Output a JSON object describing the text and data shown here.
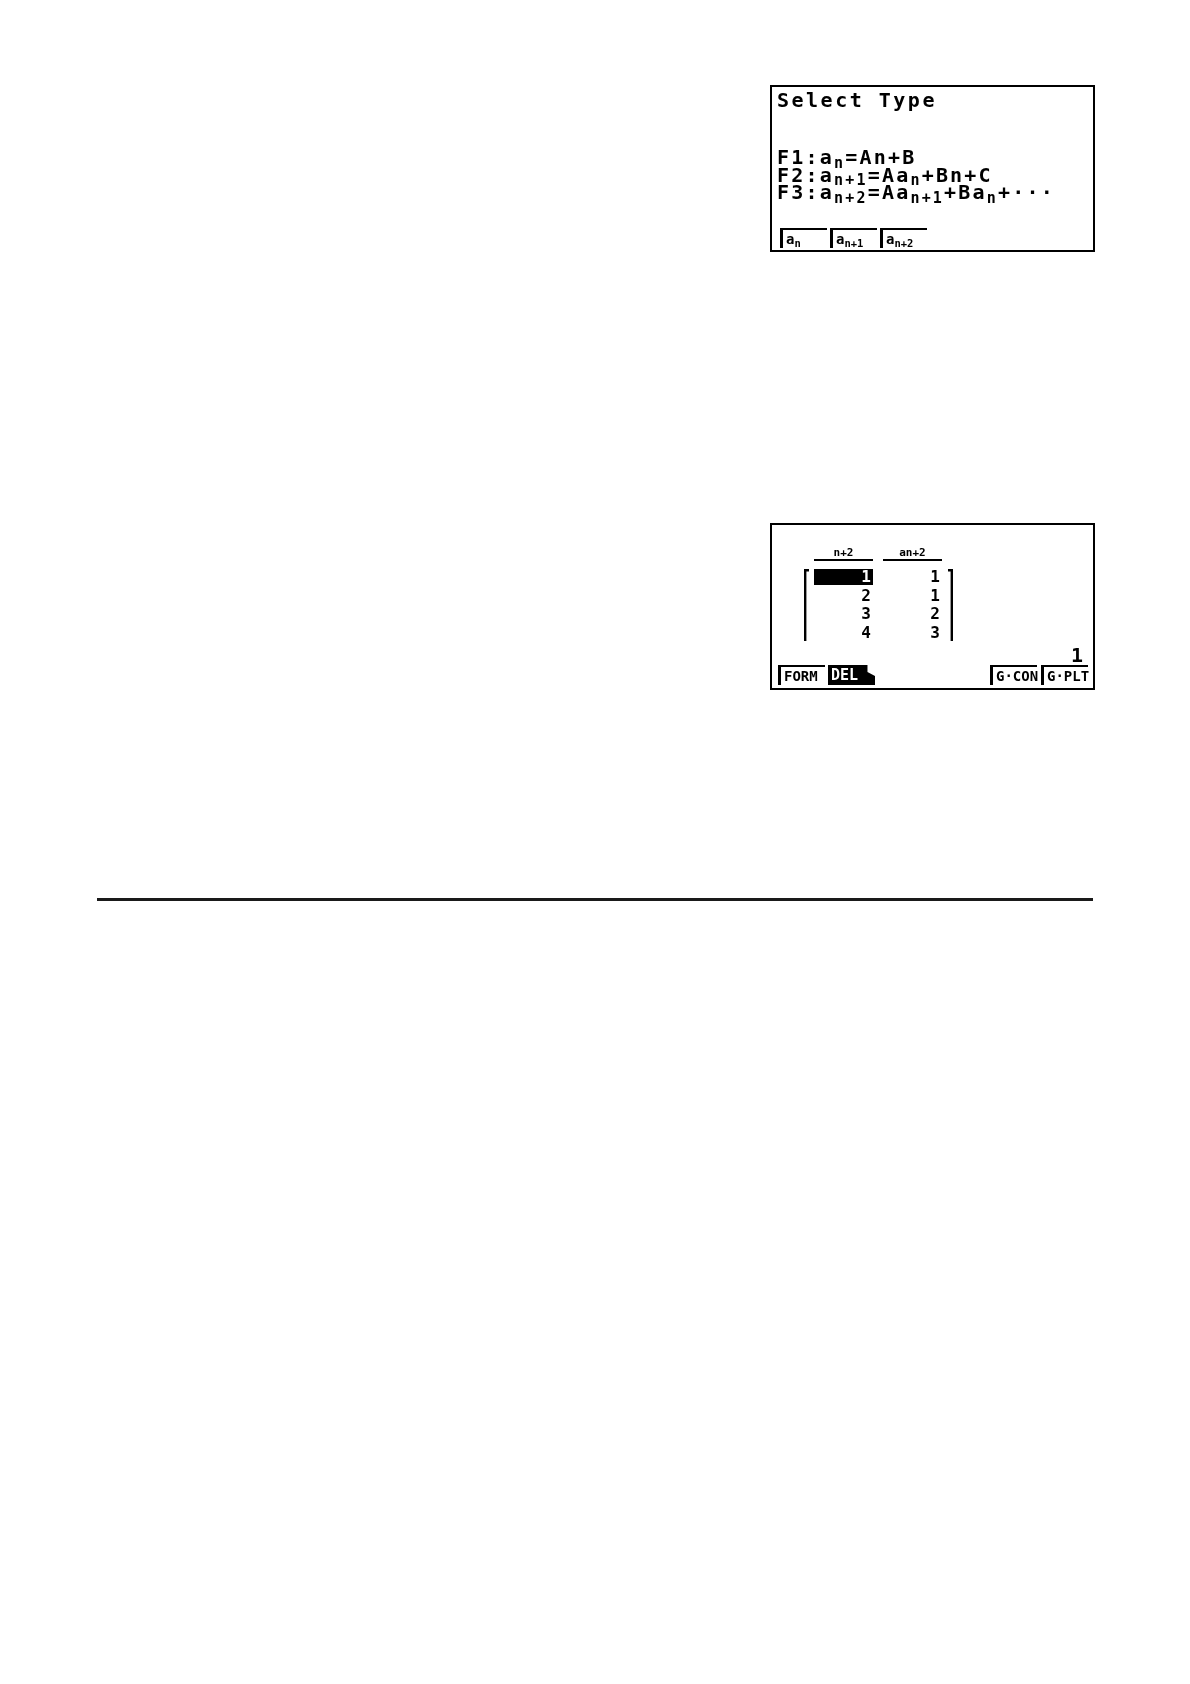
{
  "screens": [
    {
      "kind": "menu",
      "title": "Select Type",
      "options": [
        "F1:a$_{n}$=An+B",
        "F2:a$_{n+1}$=Aa$_{n}$+Bn+C",
        "F3:a$_{n+2}$=Aa$_{n+1}$+Ba$_{n}$+···"
      ],
      "function_keys": {
        "left": [
          {
            "label": "a$_{n}$",
            "kind": "tab"
          },
          {
            "label": "a$_{n+1}$",
            "kind": "tab"
          },
          {
            "label": "a$_{n+2}$",
            "kind": "tab"
          }
        ]
      }
    },
    {
      "kind": "table",
      "columns": [
        "n+2",
        "an+2"
      ],
      "rows": [
        {
          "cells": [
            {
              "value": "1",
              "selected": true
            },
            {
              "value": "1",
              "selected": false
            }
          ]
        },
        {
          "cells": [
            {
              "value": "2",
              "selected": false
            },
            {
              "value": "1",
              "selected": false
            }
          ]
        },
        {
          "cells": [
            {
              "value": "3",
              "selected": false
            },
            {
              "value": "2",
              "selected": false
            }
          ]
        },
        {
          "cells": [
            {
              "value": "4",
              "selected": false
            },
            {
              "value": "3",
              "selected": false
            }
          ]
        }
      ],
      "current_value": "1",
      "function_keys": {
        "left": [
          {
            "label": "FORM",
            "kind": "tab"
          },
          {
            "label": "DEL",
            "kind": "inverted"
          }
        ],
        "right": [
          {
            "label": "G·CON",
            "kind": "tab"
          },
          {
            "label": "G·PLT",
            "kind": "tab"
          }
        ]
      }
    }
  ]
}
